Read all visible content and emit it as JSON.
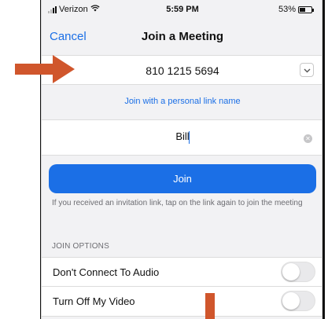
{
  "status_bar": {
    "carrier": "Verizon",
    "time": "5:59 PM",
    "battery": "53%",
    "battery_level": 0.53
  },
  "nav": {
    "cancel_label": "Cancel",
    "title": "Join a Meeting"
  },
  "meeting": {
    "id_value": "810 1215 5694"
  },
  "personal_link_label": "Join with a personal link name",
  "name_field": {
    "value": "Bill"
  },
  "join_label": "Join",
  "hint_text": "If you received an invitation link, tap on the link again to join the meeting",
  "join_options": {
    "header": "JOIN OPTIONS",
    "items": [
      {
        "label": "Don't Connect To Audio",
        "enabled": false
      },
      {
        "label": "Turn Off My Video",
        "enabled": false
      }
    ]
  },
  "colors": {
    "accent": "#1b6fe6",
    "annotation": "#d0562c",
    "background": "#f2f2f4"
  },
  "icons": {
    "dropdown": "chevron-down-icon",
    "clear": "clear-icon",
    "wifi": "wifi-icon",
    "signal": "signal-icon",
    "battery": "battery-icon"
  }
}
